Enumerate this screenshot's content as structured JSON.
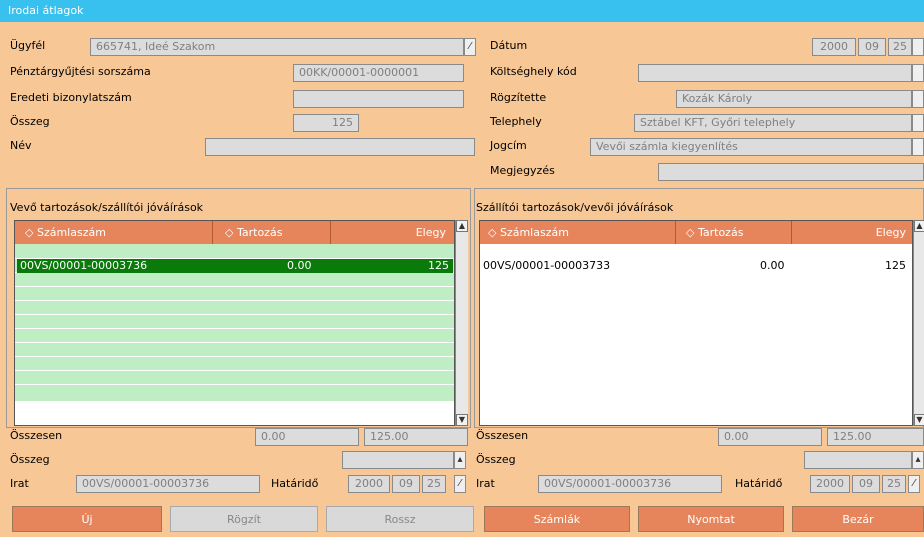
{
  "window": {
    "title": "Irodai átlagok"
  },
  "form_left": {
    "ugyfel_label": "Ügyfél",
    "ugyfel_value": "665741, Ideé Szakom",
    "penztar_label": "Pénztárgyűjtési sorszáma",
    "penztar_value": "00KK/00001-0000001",
    "eredeti_label": "Eredeti bizonylatszám",
    "eredeti_value": "",
    "osszeg_label": "Összeg",
    "osszeg_value": "125",
    "nev_label": "Név",
    "nev_value": ""
  },
  "form_right": {
    "datum_label": "Dátum",
    "datum_year": "2000",
    "datum_month": "09",
    "datum_day": "25",
    "koltseghely_label": "Költséghely kód",
    "koltseghely_value": "",
    "rogzitette_label": "Rögzítette",
    "rogzitette_value": "Kozák Károly",
    "telephely_label": "Telephely",
    "telephely_value": "Sztábel KFT, Győri telephely",
    "jogcim_label": "Jogcím",
    "jogcim_value": "Vevői számla kiegyenlítés",
    "megjegyzes_label": "Megjegyzés",
    "megjegyzes_value": ""
  },
  "left_panel": {
    "title": "Vevő tartozások/szállítói jóváírások",
    "columns": [
      "Számlaszám",
      "Tartozás",
      "Elegy"
    ],
    "rows": [
      {
        "szamlaszam": "00VS/00001-00003736",
        "tartozas": "0.00",
        "elegy": "125"
      }
    ],
    "osszesen_label": "Összesen",
    "osszesen_1": "0.00",
    "osszesen_2": "125.00",
    "osszeg_label": "Összeg",
    "osszeg_value": "",
    "irat_label": "Irat",
    "irat_value": "00VS/00001-00003736",
    "hatarido_label": "Határidő",
    "hatarido_year": "2000",
    "hatarido_month": "09",
    "hatarido_day": "25"
  },
  "right_panel": {
    "title": "Szállítói tartozások/vevői jóváírások",
    "columns": [
      "Számlaszám",
      "Tartozás",
      "Elegy"
    ],
    "rows": [
      {
        "szamlaszam": "00VS/00001-00003733",
        "tartozas": "0.00",
        "elegy": "125"
      }
    ],
    "osszesen_label": "Összesen",
    "osszesen_1": "0.00",
    "osszesen_2": "125.00",
    "osszeg_label": "Összeg",
    "osszeg_value": "",
    "irat_label": "Irat",
    "irat_value": "00VS/00001-00003736",
    "hatarido_label": "Határidő",
    "hatarido_year": "2000",
    "hatarido_month": "09",
    "hatarido_day": "25"
  },
  "buttons": {
    "uj": "Új",
    "rogzit": "Rögzít",
    "rossz": "Rossz",
    "szamlak": "Számlák",
    "nyomtat": "Nyomtat",
    "bezar": "Bezár"
  },
  "colors": {
    "background": "#f7c796",
    "titlebar": "#38c0ee",
    "header": "#e6855c",
    "selected_row": "#0a7a0a",
    "grid_row": "#bfeec4"
  },
  "icons": {
    "dropdown": "dropdown-arrow-icon",
    "sort": "sort-arrows-icon",
    "scroll_up": "scroll-up-icon",
    "scroll_down": "scroll-down-icon"
  }
}
